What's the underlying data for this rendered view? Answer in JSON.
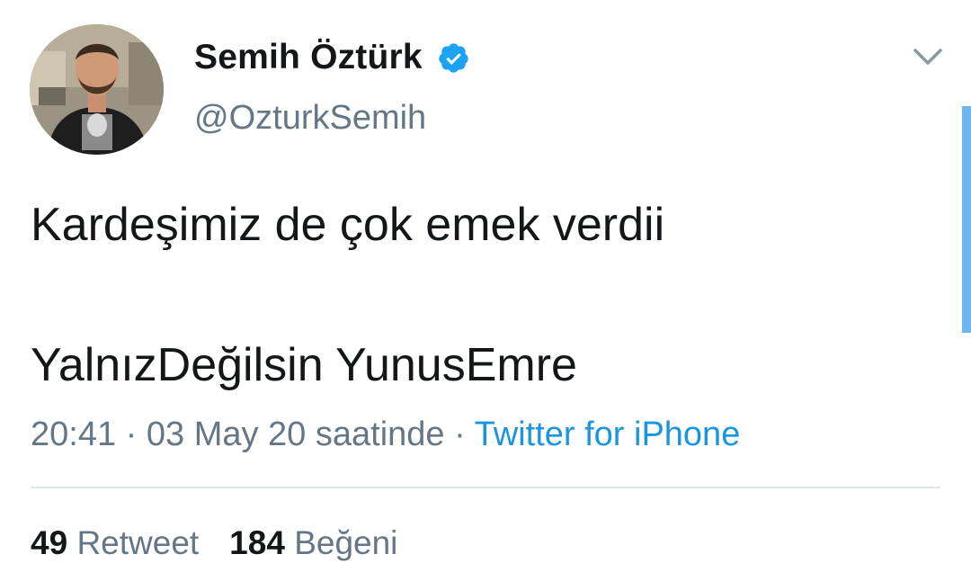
{
  "author": {
    "display_name": "Semih Öztürk",
    "handle": "@OzturkSemih",
    "verified": true
  },
  "icons": {
    "verified": "verified-badge-icon",
    "more": "chevron-down-icon",
    "avatar": "profile-avatar"
  },
  "tweet": {
    "line1": "Kardeşimiz de çok emek verdii",
    "line2": "YalnızDeğilsin YunusEmre",
    "time": "20:41",
    "separator": "·",
    "date": "03 May 20 saatinde",
    "source": "Twitter for iPhone"
  },
  "stats": {
    "retweet_count": "49",
    "retweet_label": "Retweet",
    "like_count": "184",
    "like_label": "Beğeni"
  },
  "colors": {
    "text": "#14171a",
    "muted": "#657786",
    "link": "#1b95e0",
    "verified_badge": "#1da1f2",
    "divider": "#e1e8ed",
    "scrollbar": "#6fb6f0"
  }
}
